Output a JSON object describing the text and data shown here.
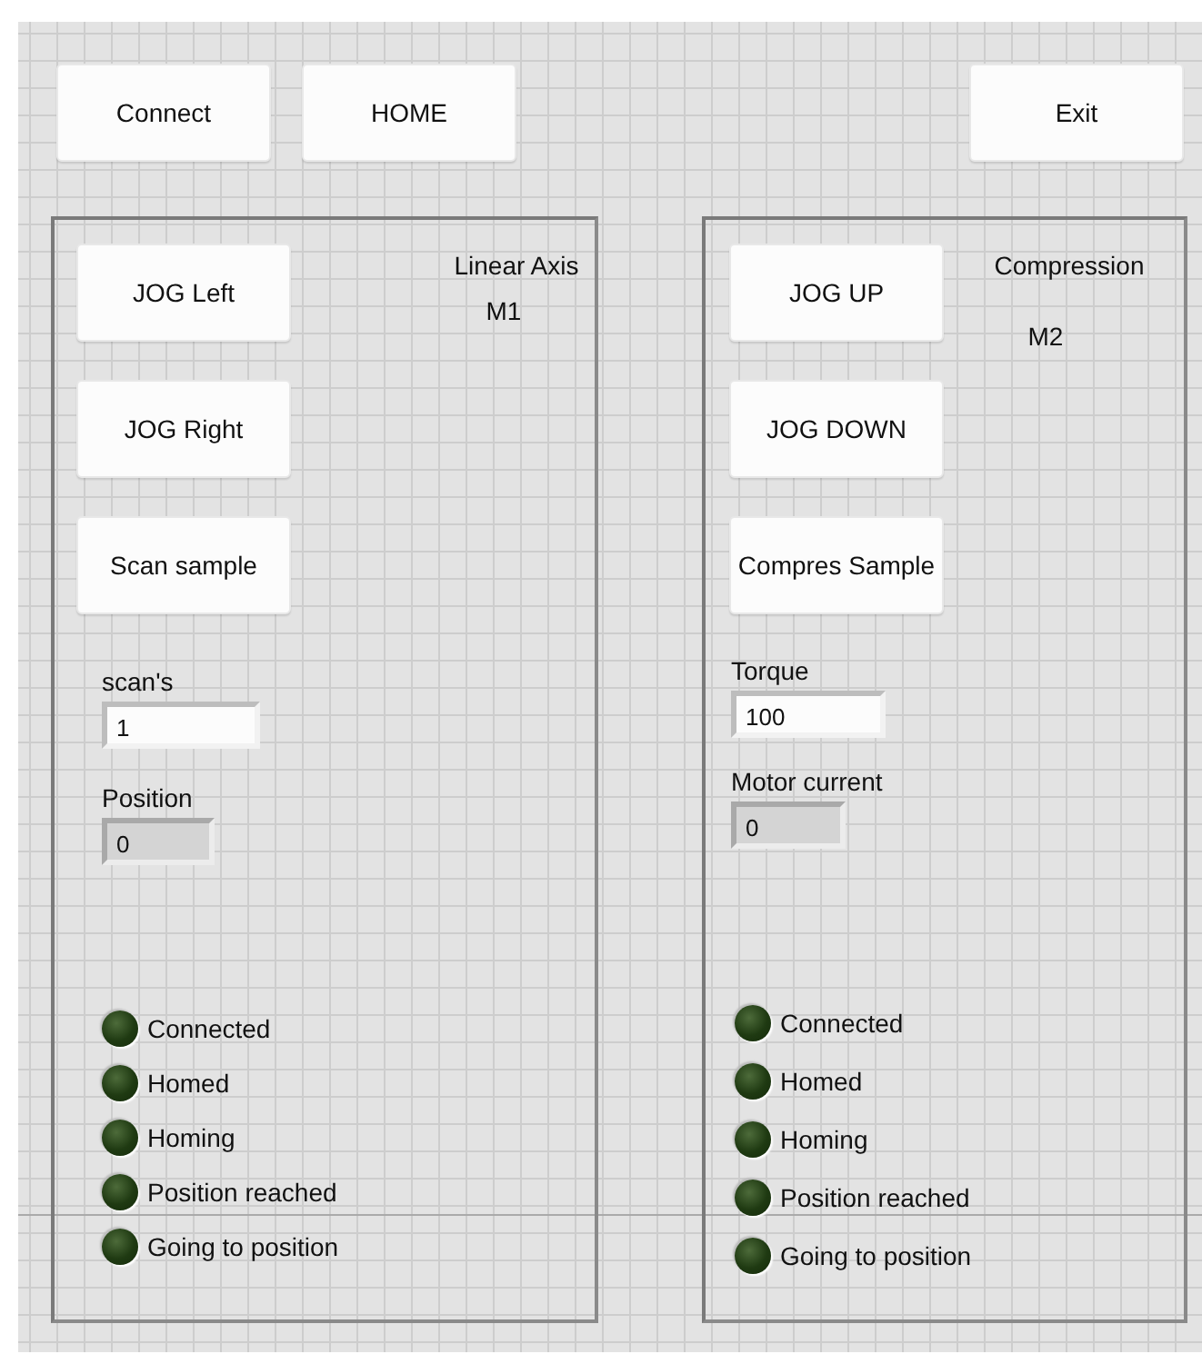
{
  "toolbar": {
    "left_buttons": [
      "Connect",
      "HOME"
    ],
    "right_buttons": [
      "Exit"
    ]
  },
  "panels": [
    {
      "title": "Linear Axis",
      "motor": "M1",
      "buttons": [
        "JOG Left",
        "JOG Right",
        "Scan sample"
      ],
      "fields": [
        {
          "label": "scan's",
          "value": "1",
          "kind": "control"
        },
        {
          "label": "Position",
          "value": "0",
          "kind": "indicator"
        }
      ],
      "leds": [
        {
          "label": "Connected",
          "on": false
        },
        {
          "label": "Homed",
          "on": false
        },
        {
          "label": "Homing",
          "on": false
        },
        {
          "label": "Position reached",
          "on": false
        },
        {
          "label": "Going to position",
          "on": false
        }
      ]
    },
    {
      "title": "Compression",
      "motor": "M2",
      "buttons": [
        "JOG UP",
        "JOG DOWN",
        "Compres Sample"
      ],
      "fields": [
        {
          "label": "Torque",
          "value": "100",
          "kind": "control"
        },
        {
          "label": "Motor current",
          "value": "0",
          "kind": "indicator"
        }
      ],
      "leds": [
        {
          "label": "Connected",
          "on": false
        },
        {
          "label": "Homed",
          "on": false
        },
        {
          "label": "Homing",
          "on": false
        },
        {
          "label": "Position reached",
          "on": false
        },
        {
          "label": "Going to position",
          "on": false
        }
      ]
    }
  ]
}
